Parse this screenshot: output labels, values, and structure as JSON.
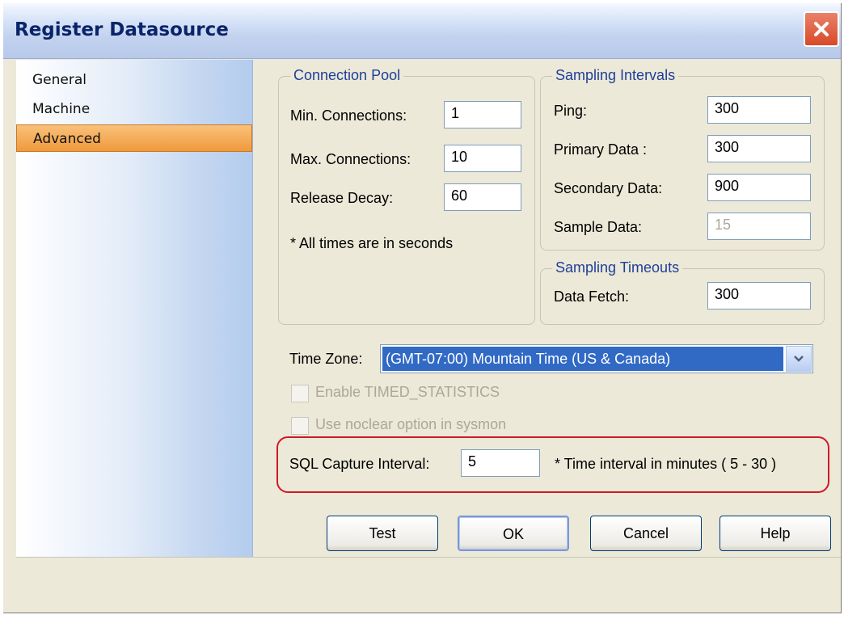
{
  "window": {
    "title": "Register Datasource"
  },
  "sidebar": {
    "items": [
      {
        "label": "General"
      },
      {
        "label": "Machine"
      },
      {
        "label": "Advanced"
      }
    ]
  },
  "connection_pool": {
    "title": "Connection Pool",
    "min_label": "Min. Connections:",
    "min_value": "1",
    "max_label": "Max. Connections:",
    "max_value": "10",
    "decay_label": "Release Decay:",
    "decay_value": "60",
    "note": "* All times are in seconds"
  },
  "sampling_intervals": {
    "title": "Sampling Intervals",
    "ping_label": "Ping:",
    "ping_value": "300",
    "primary_label": "Primary Data :",
    "primary_value": "300",
    "secondary_label": "Secondary Data:",
    "secondary_value": "900",
    "sample_label": "Sample Data:",
    "sample_value": "15"
  },
  "sampling_timeouts": {
    "title": "Sampling Timeouts",
    "fetch_label": "Data Fetch:",
    "fetch_value": "300"
  },
  "timezone": {
    "label": "Time Zone:",
    "value": "(GMT-07:00) Mountain Time (US & Canada)"
  },
  "options": {
    "timed_stats_label": "Enable TIMED_STATISTICS",
    "noclear_label": "Use noclear option in sysmon"
  },
  "sql_capture": {
    "label": "SQL Capture Interval:",
    "value": "5",
    "note": "* Time interval in minutes ( 5 - 30 )"
  },
  "buttons": {
    "test": "Test",
    "ok": "OK",
    "cancel": "Cancel",
    "help": "Help"
  }
}
